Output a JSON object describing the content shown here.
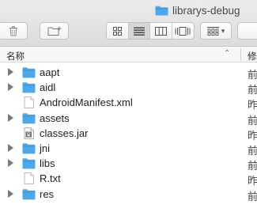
{
  "window": {
    "title": "librarys-debug"
  },
  "toolbar": {
    "trash_icon": "trash-icon",
    "new_folder_icon": "new-folder-icon",
    "view_modes": [
      "icon-view-icon",
      "list-view-icon",
      "column-view-icon",
      "cover-flow-icon"
    ],
    "active_view": "list-view-icon",
    "arrange_icon": "arrange-grid-icon",
    "chevron": "▾"
  },
  "columns": {
    "name": "名称",
    "sort_indicator": "⌃",
    "date": "修"
  },
  "files": [
    {
      "name": "aapt",
      "type": "folder",
      "expandable": true,
      "date": "前"
    },
    {
      "name": "aidl",
      "type": "folder",
      "expandable": true,
      "date": "前"
    },
    {
      "name": "AndroidManifest.xml",
      "type": "file",
      "expandable": false,
      "date": "昨"
    },
    {
      "name": "assets",
      "type": "folder",
      "expandable": true,
      "date": "前"
    },
    {
      "name": "classes.jar",
      "type": "jar",
      "expandable": false,
      "date": "昨"
    },
    {
      "name": "jni",
      "type": "folder",
      "expandable": true,
      "date": "前"
    },
    {
      "name": "libs",
      "type": "folder",
      "expandable": true,
      "date": "前"
    },
    {
      "name": "R.txt",
      "type": "file",
      "expandable": false,
      "date": "昨"
    },
    {
      "name": "res",
      "type": "folder",
      "expandable": true,
      "date": "前"
    }
  ],
  "colors": {
    "folder_blue": "#4fa8e8",
    "folder_blue_dark": "#3b92d6"
  }
}
